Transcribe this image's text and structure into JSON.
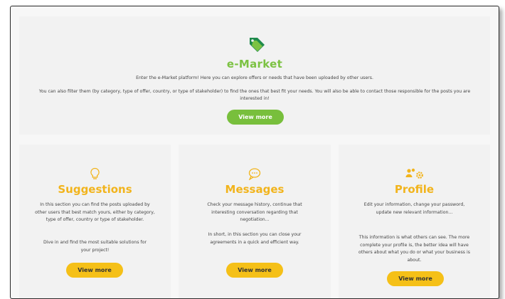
{
  "colors": {
    "green": "#78bf3c",
    "yellow": "#f2b41c",
    "background": "#f2f2f2"
  },
  "emarket": {
    "icon": "price-tag-icon",
    "title": "e-Market",
    "intro": "Enter the e-Market platform! Here you can explore offers or needs that have been uploaded by other users.",
    "description": "You can also filter them (by category, type of offer, country, or type of stakeholder) to find the ones that best fit your needs. You will also be able to contact those responsible for the posts you are interested in!",
    "button_label": "View more"
  },
  "cards": [
    {
      "icon": "lightbulb-icon",
      "title": "Suggestions",
      "text1": "In this section you can find the posts uploaded by other users that best match yours, either by category, type of offer, country or type of stakeholder.",
      "text2": "Dive in and find the most suitable solutions for your project!",
      "button_label": "View more"
    },
    {
      "icon": "chat-bubble-icon",
      "title": "Messages",
      "text1": "Check your message history, continue that interesting conversation regarding that negotiation...",
      "text2": "In short, in this section you can close your agreements in a quick and efficient way.",
      "button_label": "View more"
    },
    {
      "icon": "users-gear-icon",
      "title": "Profile",
      "text1": "Edit your information, change your password, update new relevant information...",
      "text2": "This information is what others can see. The more complete your profile is, the better idea will have others about what you do or what your business is about.",
      "button_label": "View more"
    }
  ]
}
